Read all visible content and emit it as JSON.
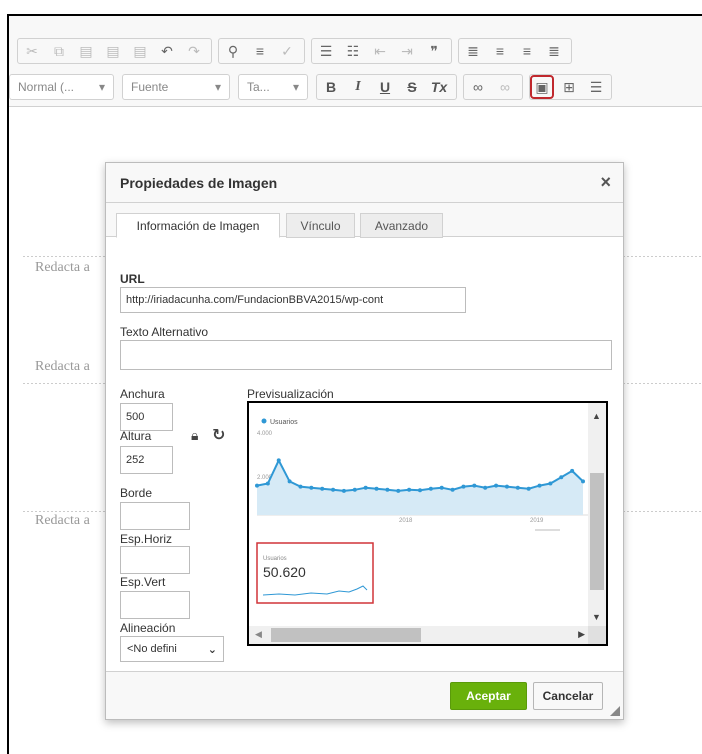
{
  "toolbar": {
    "row1_icons": [
      "cut-icon",
      "copy-icon",
      "paste-icon",
      "paste-text-icon",
      "paste-word-icon",
      "undo-icon",
      "redo-icon",
      "find-icon",
      "replace-icon",
      "spellcheck-icon",
      "numbered-list-icon",
      "bulleted-list-icon",
      "decrease-indent-icon",
      "increase-indent-icon",
      "blockquote-icon",
      "align-left-icon",
      "align-center-icon",
      "align-right-icon",
      "justify-icon"
    ],
    "format_combo": "Normal (...",
    "font_combo": "Fuente",
    "size_combo": "Ta...",
    "bold": "B",
    "italic": "I",
    "underline": "U",
    "strike": "S",
    "remove_format": "Tx",
    "highlight_color": "#c0282d"
  },
  "document": {
    "hint1": "Redacta a",
    "hint2": "Redacta a",
    "hint3": "Redacta a"
  },
  "dialog": {
    "title": "Propiedades de Imagen",
    "close_glyph": "×",
    "tabs": [
      {
        "label": "Información de Imagen",
        "active": true
      },
      {
        "label": "Vínculo",
        "active": false
      },
      {
        "label": "Avanzado",
        "active": false
      }
    ],
    "url_label": "URL",
    "url_value": "http://iriadacunha.com/FundacionBBVA2015/wp-cont",
    "alt_label": "Texto Alternativo",
    "alt_value": "",
    "width_label": "Anchura",
    "width_value": "500",
    "height_label": "Altura",
    "height_value": "252",
    "border_label": "Borde",
    "border_value": "",
    "hspace_label": "Esp.Horiz",
    "hspace_value": "",
    "vspace_label": "Esp.Vert",
    "vspace_value": "",
    "align_label": "Alineación",
    "align_value": "<No defini",
    "preview_label": "Previsualización",
    "ok_label": "Aceptar",
    "cancel_label": "Cancelar",
    "ok_color": "#69b10b"
  },
  "preview_chart": {
    "series_name": "Usuarios",
    "y_tick_top": "4.000",
    "y_tick_mid": "2.000",
    "x_tick_1": "2018",
    "x_tick_2": "2019",
    "card_label": "Usuarios",
    "card_value": "50.620",
    "series_color": "#2f98d5",
    "card_border_color": "#d13438",
    "values": [
      1400,
      1500,
      2600,
      1600,
      1350,
      1300,
      1250,
      1200,
      1150,
      1200,
      1300,
      1250,
      1200,
      1150,
      1200,
      1180,
      1250,
      1300,
      1200,
      1350,
      1400,
      1300,
      1400,
      1350,
      1300,
      1250,
      1400,
      1500,
      1800,
      2100,
      1600
    ]
  }
}
